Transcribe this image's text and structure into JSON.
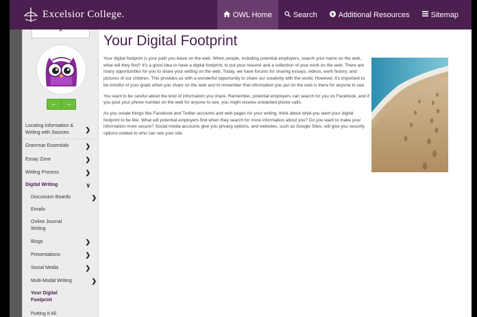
{
  "header": {
    "logo_text": "Excelsior College.",
    "nav": [
      {
        "label": "OWL Home",
        "icon": "home-icon"
      },
      {
        "label": "Search",
        "icon": "search-icon"
      },
      {
        "label": "Additional Resources",
        "icon": "plus-circle-icon"
      },
      {
        "label": "Sitemap",
        "icon": "list-icon"
      }
    ]
  },
  "sidebar": {
    "items": [
      {
        "label": "Locating Information & Writing with Sources",
        "has_chevron": true,
        "level": 1
      },
      {
        "label": "Grammar Essentials",
        "has_chevron": true,
        "level": 1
      },
      {
        "label": "Essay Zone",
        "has_chevron": true,
        "level": 1
      },
      {
        "label": "Writing Process",
        "has_chevron": true,
        "level": 1
      },
      {
        "label": "Digital Writing",
        "has_chevron": true,
        "level": 1,
        "expanded": true
      },
      {
        "label": "Discussion Boards",
        "has_chevron": true,
        "level": 2
      },
      {
        "label": "Emails",
        "has_chevron": false,
        "level": 2
      },
      {
        "label": "Online Journal Writing",
        "has_chevron": false,
        "level": 2
      },
      {
        "label": "Blogs",
        "has_chevron": true,
        "level": 2
      },
      {
        "label": "Presentations",
        "has_chevron": true,
        "level": 2
      },
      {
        "label": "Social Media",
        "has_chevron": true,
        "level": 2
      },
      {
        "label": "Multi-Modal Writing",
        "has_chevron": true,
        "level": 2
      },
      {
        "label": "Your Digital Footprint",
        "has_chevron": false,
        "level": 2,
        "active": true
      },
      {
        "label": "Putting It All Together",
        "has_chevron": false,
        "level": 2
      }
    ]
  },
  "content": {
    "title": "Your Digital Footprint",
    "paragraphs": [
      "Your digital footprint is your path you leave on the web. When people, including potential employers, search your name on the web, what will they find? It's a good idea to have a digital footprint, to put your resume and a collection of your work on the web. There are many opportunities for you to share your writing on the web. Today, we have forums for sharing essays, videos, work history, and pictures of our children. This provides us with a wonderful opportunity to share our creativity with the world. However, it's important to be mindful of your goals when you share on the web and to remember that information you put on the web is there for anyone to see.",
      "You want to be careful about the kind of information you share. Remember, potential employers can search for you on Facebook, and if you post your phone number on the web for anyone to see, you might receive unwanted phone calls.",
      "As you create things like Facebook and Twitter accounts and web pages for your writing, think about what you want your digital footprint to be like. What will potential employers find when they search for more information about you? Do you want to make your information more secure? Social media accounts give you privacy options, and websites, such as Google Sites, will give you security options related to who can see your site."
    ]
  },
  "colors": {
    "brand_purple": "#4b1f4f",
    "active_tab": "#6a3d6e",
    "nav_green": "#6cbf3b"
  }
}
